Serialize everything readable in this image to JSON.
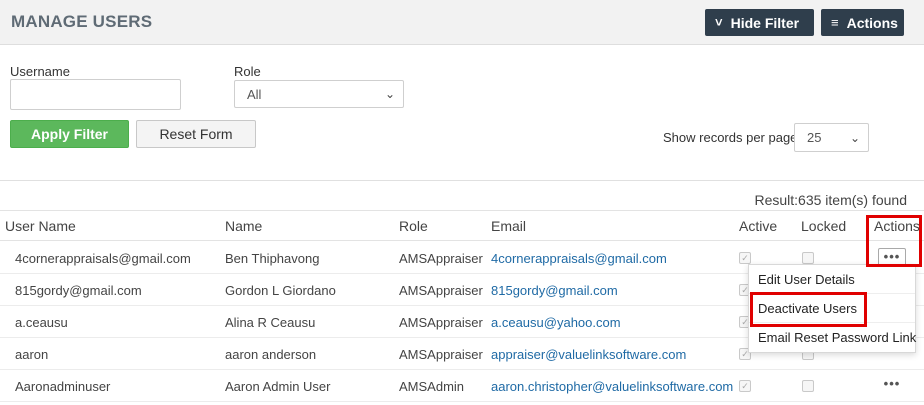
{
  "header": {
    "title": "MANAGE USERS",
    "hide_filter_label": "Hide Filter",
    "actions_label": "Actions"
  },
  "filters": {
    "username_label": "Username",
    "username_value": "",
    "role_label": "Role",
    "role_selected": "All",
    "apply_label": "Apply Filter",
    "reset_label": "Reset Form",
    "records_label": "Show records per page",
    "records_selected": "25"
  },
  "result_text": "Result:635 item(s) found",
  "table": {
    "columns": [
      "User Name",
      "Name",
      "Role",
      "Email",
      "Active",
      "Locked",
      "Actions"
    ],
    "rows": [
      {
        "username": "4cornerappraisals@gmail.com",
        "name": "Ben Thiphavong",
        "role": "AMSAppraiser",
        "email": "4cornerappraisals@gmail.com",
        "active": true,
        "locked": false
      },
      {
        "username": "815gordy@gmail.com",
        "name": "Gordon L Giordano",
        "role": "AMSAppraiser",
        "email": "815gordy@gmail.com",
        "active": true,
        "locked": false
      },
      {
        "username": "a.ceausu",
        "name": "Alina R Ceausu",
        "role": "AMSAppraiser",
        "email": "a.ceausu@yahoo.com",
        "active": true,
        "locked": false
      },
      {
        "username": "aaron",
        "name": "aaron anderson",
        "role": "AMSAppraiser",
        "email": "appraiser@valuelinksoftware.com",
        "active": true,
        "locked": false
      },
      {
        "username": "Aaronadminuser",
        "name": "Aaron Admin User",
        "role": "AMSAdmin",
        "email": "aaron.christopher@valuelinksoftware.com",
        "active": true,
        "locked": false
      }
    ]
  },
  "actions_menu": {
    "items": [
      "Edit User Details",
      "Deactivate Users",
      "Email Reset Password Link"
    ]
  },
  "icons": {
    "hide_filter": "chevrons-up-icon",
    "actions": "menu-lines-icon",
    "row_actions": "ellipsis-icon",
    "select": "chevron-down-icon"
  },
  "colors": {
    "header_button": "#2f3e4c",
    "apply_button": "#5cb85c",
    "link": "#1f6aa5",
    "highlight": "#e00000"
  }
}
